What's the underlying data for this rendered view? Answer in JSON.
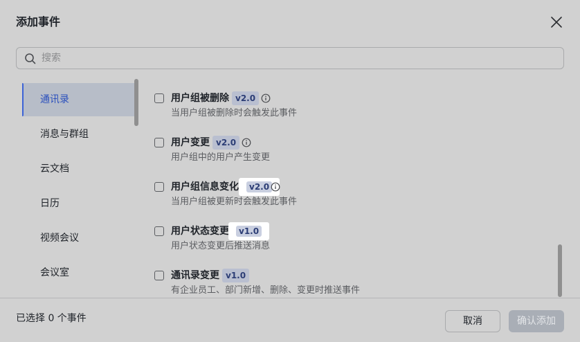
{
  "dialog": {
    "title": "添加事件",
    "close_icon": "close-icon"
  },
  "search": {
    "placeholder": "搜索",
    "value": "",
    "icon": "search-icon"
  },
  "sidebar": {
    "items": [
      {
        "label": "通讯录",
        "active": true
      },
      {
        "label": "消息与群组",
        "active": false
      },
      {
        "label": "云文档",
        "active": false
      },
      {
        "label": "日历",
        "active": false
      },
      {
        "label": "视频会议",
        "active": false
      },
      {
        "label": "会议室",
        "active": false
      }
    ]
  },
  "events": [
    {
      "name": "用户组被删除",
      "version": "v2.0",
      "has_info": true,
      "desc": "当用户组被删除时会触发此事件",
      "checked": false
    },
    {
      "name": "用户变更",
      "version": "v2.0",
      "has_info": true,
      "desc": "用户组中的用户产生变更",
      "checked": false
    },
    {
      "name": "用户组信息变化",
      "version": "v2.0",
      "has_info": true,
      "desc": "当用户组被更新时会触发此事件",
      "checked": false
    },
    {
      "name": "用户状态变更",
      "version": "v1.0",
      "has_info": false,
      "desc": "用户状态变更后推送消息",
      "checked": false
    },
    {
      "name": "通讯录变更",
      "version": "v1.0",
      "has_info": false,
      "desc": "有企业员工、部门新增、删除、变更时推送事件",
      "checked": false
    }
  ],
  "footer": {
    "selected_text": "已选择 0 个事件",
    "cancel_label": "取消",
    "confirm_label": "确认添加",
    "confirm_enabled": false
  },
  "colors": {
    "accent": "#3b62d6",
    "badge_bg": "#b9bfd0",
    "badge_text": "#2c3d75"
  }
}
